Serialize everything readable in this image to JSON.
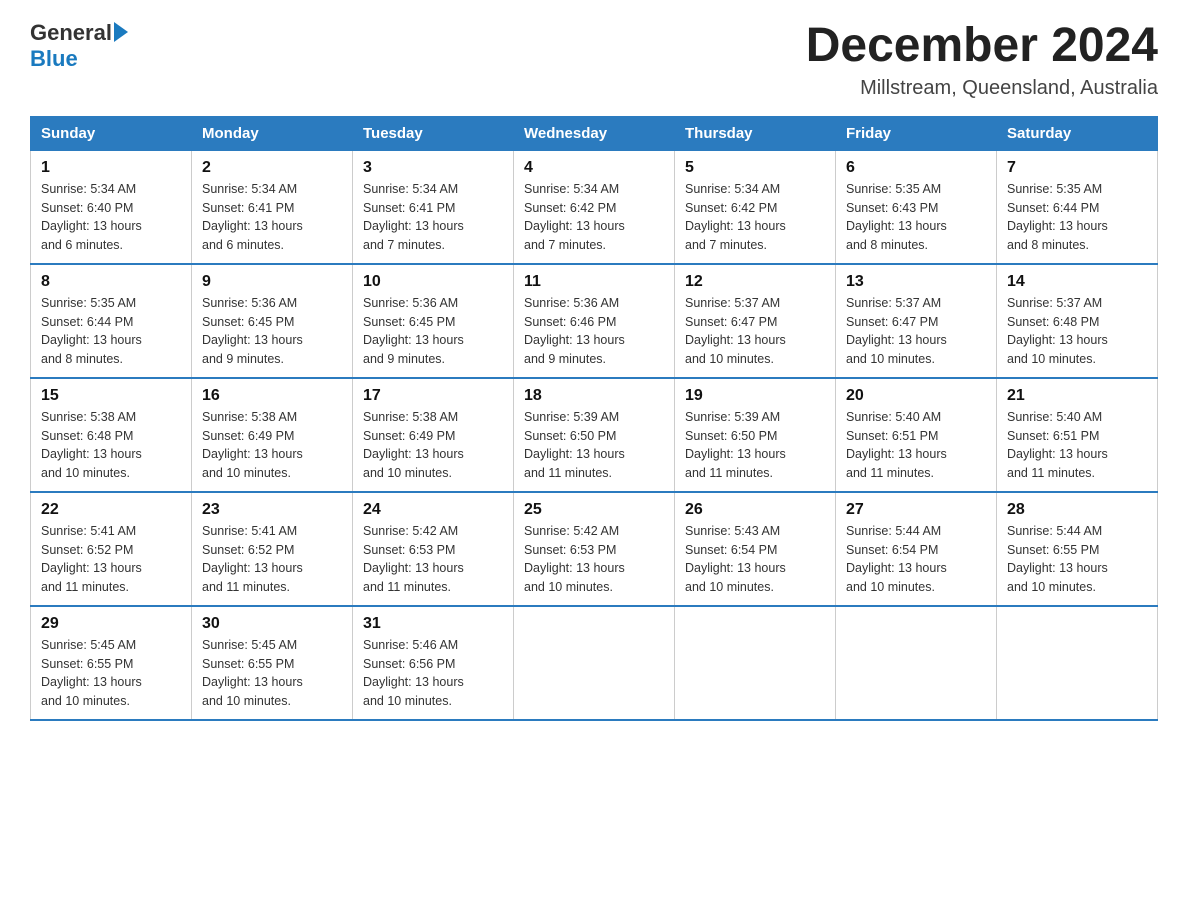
{
  "logo": {
    "text_general": "General",
    "text_blue": "Blue"
  },
  "title": "December 2024",
  "subtitle": "Millstream, Queensland, Australia",
  "days_of_week": [
    "Sunday",
    "Monday",
    "Tuesday",
    "Wednesday",
    "Thursday",
    "Friday",
    "Saturday"
  ],
  "weeks": [
    [
      {
        "day": "1",
        "info": "Sunrise: 5:34 AM\nSunset: 6:40 PM\nDaylight: 13 hours\nand 6 minutes."
      },
      {
        "day": "2",
        "info": "Sunrise: 5:34 AM\nSunset: 6:41 PM\nDaylight: 13 hours\nand 6 minutes."
      },
      {
        "day": "3",
        "info": "Sunrise: 5:34 AM\nSunset: 6:41 PM\nDaylight: 13 hours\nand 7 minutes."
      },
      {
        "day": "4",
        "info": "Sunrise: 5:34 AM\nSunset: 6:42 PM\nDaylight: 13 hours\nand 7 minutes."
      },
      {
        "day": "5",
        "info": "Sunrise: 5:34 AM\nSunset: 6:42 PM\nDaylight: 13 hours\nand 7 minutes."
      },
      {
        "day": "6",
        "info": "Sunrise: 5:35 AM\nSunset: 6:43 PM\nDaylight: 13 hours\nand 8 minutes."
      },
      {
        "day": "7",
        "info": "Sunrise: 5:35 AM\nSunset: 6:44 PM\nDaylight: 13 hours\nand 8 minutes."
      }
    ],
    [
      {
        "day": "8",
        "info": "Sunrise: 5:35 AM\nSunset: 6:44 PM\nDaylight: 13 hours\nand 8 minutes."
      },
      {
        "day": "9",
        "info": "Sunrise: 5:36 AM\nSunset: 6:45 PM\nDaylight: 13 hours\nand 9 minutes."
      },
      {
        "day": "10",
        "info": "Sunrise: 5:36 AM\nSunset: 6:45 PM\nDaylight: 13 hours\nand 9 minutes."
      },
      {
        "day": "11",
        "info": "Sunrise: 5:36 AM\nSunset: 6:46 PM\nDaylight: 13 hours\nand 9 minutes."
      },
      {
        "day": "12",
        "info": "Sunrise: 5:37 AM\nSunset: 6:47 PM\nDaylight: 13 hours\nand 10 minutes."
      },
      {
        "day": "13",
        "info": "Sunrise: 5:37 AM\nSunset: 6:47 PM\nDaylight: 13 hours\nand 10 minutes."
      },
      {
        "day": "14",
        "info": "Sunrise: 5:37 AM\nSunset: 6:48 PM\nDaylight: 13 hours\nand 10 minutes."
      }
    ],
    [
      {
        "day": "15",
        "info": "Sunrise: 5:38 AM\nSunset: 6:48 PM\nDaylight: 13 hours\nand 10 minutes."
      },
      {
        "day": "16",
        "info": "Sunrise: 5:38 AM\nSunset: 6:49 PM\nDaylight: 13 hours\nand 10 minutes."
      },
      {
        "day": "17",
        "info": "Sunrise: 5:38 AM\nSunset: 6:49 PM\nDaylight: 13 hours\nand 10 minutes."
      },
      {
        "day": "18",
        "info": "Sunrise: 5:39 AM\nSunset: 6:50 PM\nDaylight: 13 hours\nand 11 minutes."
      },
      {
        "day": "19",
        "info": "Sunrise: 5:39 AM\nSunset: 6:50 PM\nDaylight: 13 hours\nand 11 minutes."
      },
      {
        "day": "20",
        "info": "Sunrise: 5:40 AM\nSunset: 6:51 PM\nDaylight: 13 hours\nand 11 minutes."
      },
      {
        "day": "21",
        "info": "Sunrise: 5:40 AM\nSunset: 6:51 PM\nDaylight: 13 hours\nand 11 minutes."
      }
    ],
    [
      {
        "day": "22",
        "info": "Sunrise: 5:41 AM\nSunset: 6:52 PM\nDaylight: 13 hours\nand 11 minutes."
      },
      {
        "day": "23",
        "info": "Sunrise: 5:41 AM\nSunset: 6:52 PM\nDaylight: 13 hours\nand 11 minutes."
      },
      {
        "day": "24",
        "info": "Sunrise: 5:42 AM\nSunset: 6:53 PM\nDaylight: 13 hours\nand 11 minutes."
      },
      {
        "day": "25",
        "info": "Sunrise: 5:42 AM\nSunset: 6:53 PM\nDaylight: 13 hours\nand 10 minutes."
      },
      {
        "day": "26",
        "info": "Sunrise: 5:43 AM\nSunset: 6:54 PM\nDaylight: 13 hours\nand 10 minutes."
      },
      {
        "day": "27",
        "info": "Sunrise: 5:44 AM\nSunset: 6:54 PM\nDaylight: 13 hours\nand 10 minutes."
      },
      {
        "day": "28",
        "info": "Sunrise: 5:44 AM\nSunset: 6:55 PM\nDaylight: 13 hours\nand 10 minutes."
      }
    ],
    [
      {
        "day": "29",
        "info": "Sunrise: 5:45 AM\nSunset: 6:55 PM\nDaylight: 13 hours\nand 10 minutes."
      },
      {
        "day": "30",
        "info": "Sunrise: 5:45 AM\nSunset: 6:55 PM\nDaylight: 13 hours\nand 10 minutes."
      },
      {
        "day": "31",
        "info": "Sunrise: 5:46 AM\nSunset: 6:56 PM\nDaylight: 13 hours\nand 10 minutes."
      },
      null,
      null,
      null,
      null
    ]
  ]
}
